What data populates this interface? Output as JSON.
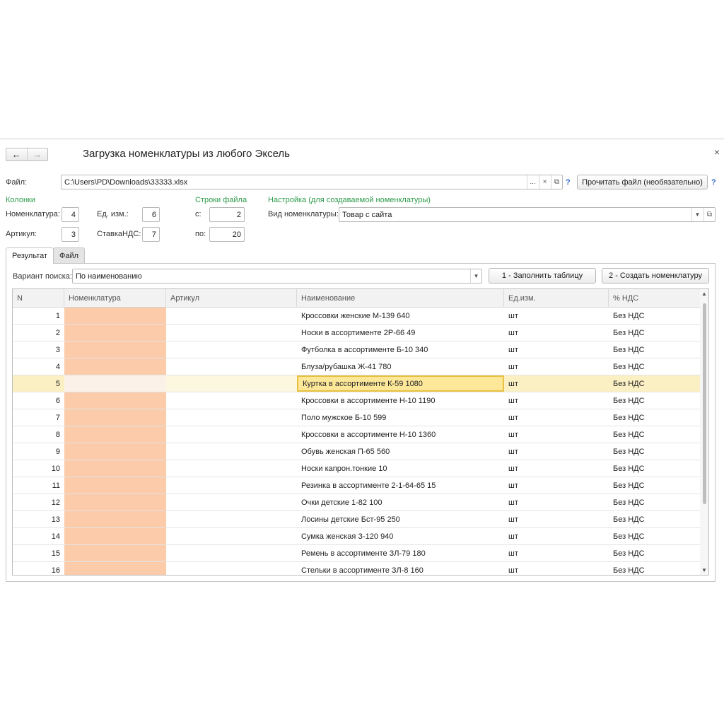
{
  "window": {
    "title": "Загрузка номенклатуры из любого Эксель",
    "back_icon": "←",
    "forward_icon": "→",
    "close_icon": "×"
  },
  "file": {
    "label": "Файл:",
    "value": "C:\\Users\\PD\\Downloads\\33333.xlsx",
    "browse": "...",
    "clear": "×",
    "open": "⧉",
    "help": "?",
    "read_button": "Прочитать файл (необязательно)",
    "read_help": "?"
  },
  "columns": {
    "header": "Колонки",
    "nomenclature_label": "Номенклатура:",
    "nomenclature_value": "4",
    "unit_label": "Ед. изм.:",
    "unit_value": "6",
    "article_label": "Артикул:",
    "article_value": "3",
    "vat_label": "СтавкаНДС:",
    "vat_value": "7"
  },
  "rows_range": {
    "header": "Строки файла",
    "from_label": "с:",
    "from_value": "2",
    "to_label": "по:",
    "to_value": "20"
  },
  "settings": {
    "header": "Настройка (для создаваемой номенклатуры)",
    "kind_label": "Вид номенклатуры:",
    "kind_value": "Товар с сайта"
  },
  "tabs": [
    {
      "label": "Результат"
    },
    {
      "label": "Файл"
    }
  ],
  "search": {
    "label": "Вариант поиска:",
    "value": "По наименованию"
  },
  "buttons": {
    "fill_table": "1 - Заполнить таблицу",
    "create_nomenclature": "2 - Создать номенклатуру"
  },
  "table": {
    "headers": [
      "N",
      "Номенклатура",
      "Артикул",
      "Наименование",
      "Ед.изм.",
      "% НДС"
    ],
    "rows": [
      {
        "n": "1",
        "name": "Кроссовки женские М-139 640",
        "unit": "шт",
        "vat": "Без НДС"
      },
      {
        "n": "2",
        "name": "Носки в ассортименте 2Р-66 49",
        "unit": "шт",
        "vat": "Без НДС"
      },
      {
        "n": "3",
        "name": "Футболка в ассортименте Б-10 340",
        "unit": "шт",
        "vat": "Без НДС"
      },
      {
        "n": "4",
        "name": "Блуза/рубашка Ж-41 780",
        "unit": "шт",
        "vat": "Без НДС"
      },
      {
        "n": "5",
        "name": "Куртка в ассортименте К-59 1080",
        "unit": "шт",
        "vat": "Без НДС"
      },
      {
        "n": "6",
        "name": "Кроссовки в ассортименте Н-10 1190",
        "unit": "шт",
        "vat": "Без НДС"
      },
      {
        "n": "7",
        "name": "Поло мужское Б-10 599",
        "unit": "шт",
        "vat": "Без НДС"
      },
      {
        "n": "8",
        "name": "Кроссовки в ассортименте Н-10 1360",
        "unit": "шт",
        "vat": "Без НДС"
      },
      {
        "n": "9",
        "name": "Обувь женская П-65 560",
        "unit": "шт",
        "vat": "Без НДС"
      },
      {
        "n": "10",
        "name": "Носки капрон.тонкие 10",
        "unit": "шт",
        "vat": "Без НДС"
      },
      {
        "n": "11",
        "name": "Резинка в ассортименте 2-1-64-65 15",
        "unit": "шт",
        "vat": "Без НДС"
      },
      {
        "n": "12",
        "name": "Очки детские 1-82 100",
        "unit": "шт",
        "vat": "Без НДС"
      },
      {
        "n": "13",
        "name": "Лосины детские Бст-95 250",
        "unit": "шт",
        "vat": "Без НДС"
      },
      {
        "n": "14",
        "name": "Сумка женская З-120 940",
        "unit": "шт",
        "vat": "Без НДС"
      },
      {
        "n": "15",
        "name": "Ремень в ассортименте ЗЛ-79 180",
        "unit": "шт",
        "vat": "Без НДС"
      },
      {
        "n": "16",
        "name": "Стельки в ассортименте ЗЛ-8 160",
        "unit": "шт",
        "vat": "Без НДС"
      }
    ],
    "selected_row": "5"
  },
  "colors": {
    "accent_green": "#2e9b4b",
    "unmatched_cell": "#fbcbaa",
    "selected_row": "#fbf0c4",
    "active_cell_border": "#e8c140"
  },
  "icons": {
    "dropdown": "chevron-down-icon",
    "open": "open-window-icon",
    "scroll_up": "scroll-up-icon",
    "scroll_down": "scroll-down-icon"
  }
}
